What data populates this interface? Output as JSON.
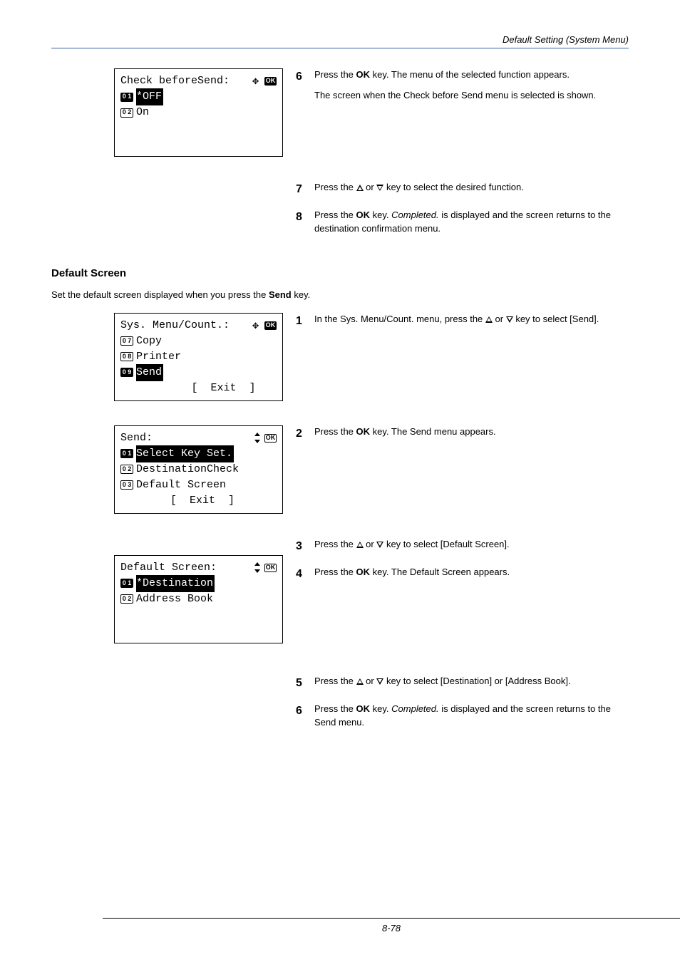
{
  "header": {
    "title": "Default Setting (System Menu)"
  },
  "footer": {
    "page": "8-78"
  },
  "lcd1": {
    "title": "Check beforeSend:",
    "opt1_num": "0 1",
    "opt1_label": "*OFF",
    "opt2_num": "0 2",
    "opt2_label": "On"
  },
  "steps_a": {
    "s6_num": "6",
    "s6_text_a": "Press the ",
    "s6_text_b": "OK",
    "s6_text_c": " key. The menu of the selected function appears.",
    "s6_text_d": "The screen when the Check before Send menu is selected is shown.",
    "s7_num": "7",
    "s7_text_a": "Press the ",
    "s7_text_b": " or ",
    "s7_text_c": " key to select the desired function.",
    "s8_num": "8",
    "s8_text_a": "Press the ",
    "s8_text_b": "OK",
    "s8_text_c": " key. ",
    "s8_text_d": "Completed.",
    "s8_text_e": " is displayed and the screen returns to the destination confirmation menu."
  },
  "heading": "Default Screen",
  "intro_a": "Set the default screen displayed when you press the ",
  "intro_b": "Send",
  "intro_c": " key.",
  "lcd2": {
    "title": "Sys. Menu/Count.:",
    "opt1_num": "0 7",
    "opt1_label": "Copy",
    "opt2_num": "0 8",
    "opt2_label": "Printer",
    "opt3_num": "0 9",
    "opt3_label": "Send",
    "exit": "[  Exit  ]"
  },
  "lcd3": {
    "title": "Send:",
    "opt1_num": "0 1",
    "opt1_label": "Select Key Set.",
    "opt2_num": "0 2",
    "opt2_label": "DestinationCheck",
    "opt3_num": "0 3",
    "opt3_label": "Default Screen",
    "exit": "[  Exit  ]"
  },
  "lcd4": {
    "title": "Default Screen:",
    "opt1_num": "0 1",
    "opt1_label": "*Destination",
    "opt2_num": "0 2",
    "opt2_label": "Address Book"
  },
  "steps_b": {
    "s1_num": "1",
    "s1_text_a": "In the Sys. Menu/Count. menu, press the ",
    "s1_text_b": " or ",
    "s1_text_c": " key to select [Send].",
    "s2_num": "2",
    "s2_text_a": "Press the ",
    "s2_text_b": "OK",
    "s2_text_c": " key. The Send menu appears.",
    "s3_num": "3",
    "s3_text_a": "Press the ",
    "s3_text_b": " or ",
    "s3_text_c": " key to select [Default Screen].",
    "s4_num": "4",
    "s4_text_a": "Press the ",
    "s4_text_b": "OK",
    "s4_text_c": " key. The Default Screen appears.",
    "s5_num": "5",
    "s5_text_a": "Press the ",
    "s5_text_b": " or ",
    "s5_text_c": " key to select [Destination] or [Address Book].",
    "s6_num": "6",
    "s6_text_a": "Press the ",
    "s6_text_b": "OK",
    "s6_text_c": " key. ",
    "s6_text_d": "Completed.",
    "s6_text_e": " is displayed and the screen returns to the Send menu."
  }
}
